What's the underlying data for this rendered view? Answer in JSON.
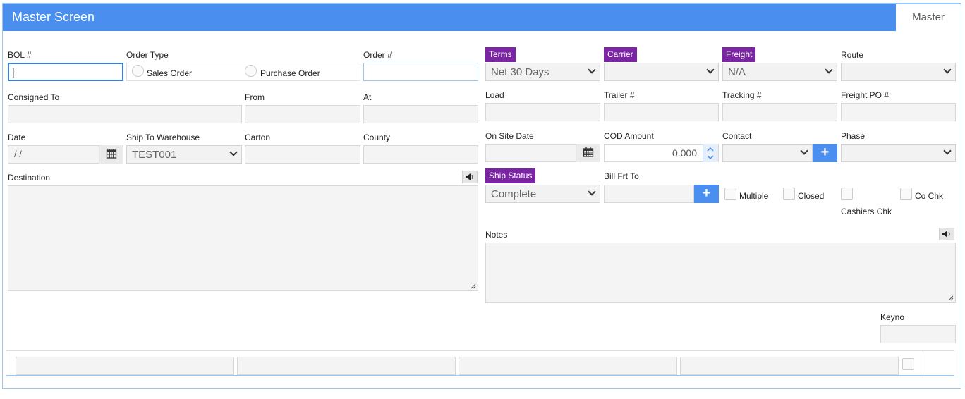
{
  "header": {
    "title": "Master Screen",
    "tab": "Master"
  },
  "fields": {
    "bol": {
      "label": "BOL #",
      "value": "|"
    },
    "order_type": {
      "label": "Order Type",
      "option1": "Sales Order",
      "option2": "Purchase Order"
    },
    "order_no": {
      "label": "Order #",
      "value": ""
    },
    "terms": {
      "label": "Terms",
      "value": "Net 30 Days"
    },
    "carrier": {
      "label": "Carrier",
      "value": ""
    },
    "freight": {
      "label": "Freight",
      "value": "N/A"
    },
    "route": {
      "label": "Route",
      "value": ""
    },
    "consigned_to": {
      "label": "Consigned To",
      "value": ""
    },
    "from": {
      "label": "From",
      "value": ""
    },
    "at": {
      "label": "At",
      "value": ""
    },
    "load": {
      "label": "Load",
      "value": ""
    },
    "trailer": {
      "label": "Trailer #",
      "value": ""
    },
    "tracking": {
      "label": "Tracking #",
      "value": ""
    },
    "freight_po": {
      "label": "Freight PO #",
      "value": ""
    },
    "date": {
      "label": "Date",
      "value": " / /"
    },
    "ship_to_wh": {
      "label": "Ship To Warehouse",
      "value": "TEST001"
    },
    "carton": {
      "label": "Carton",
      "value": ""
    },
    "county": {
      "label": "County",
      "value": ""
    },
    "on_site_date": {
      "label": "On Site Date",
      "value": ""
    },
    "cod_amount": {
      "label": "COD Amount",
      "value": "0.000"
    },
    "contact": {
      "label": "Contact",
      "value": ""
    },
    "phase": {
      "label": "Phase",
      "value": ""
    },
    "destination": {
      "label": "Destination",
      "value": ""
    },
    "ship_status": {
      "label": "Ship Status",
      "value": "Complete"
    },
    "bill_frt_to": {
      "label": "Bill Frt To",
      "value": ""
    },
    "multiple": {
      "label": "Multiple"
    },
    "closed": {
      "label": "Closed"
    },
    "cashiers_chk": {
      "label": "Cashiers Chk"
    },
    "co_chk": {
      "label": "Co Chk"
    },
    "notes": {
      "label": "Notes",
      "value": ""
    },
    "keyno": {
      "label": "Keyno",
      "value": ""
    }
  },
  "icons": {
    "calendar": "calendar-icon",
    "speaker": "speaker-icon",
    "plus": "plus-icon",
    "chevron": "chevron-down-icon"
  },
  "colors": {
    "header": "#4a8ef0",
    "purple_label": "#7b24a4",
    "accent": "#4a8ef0"
  }
}
